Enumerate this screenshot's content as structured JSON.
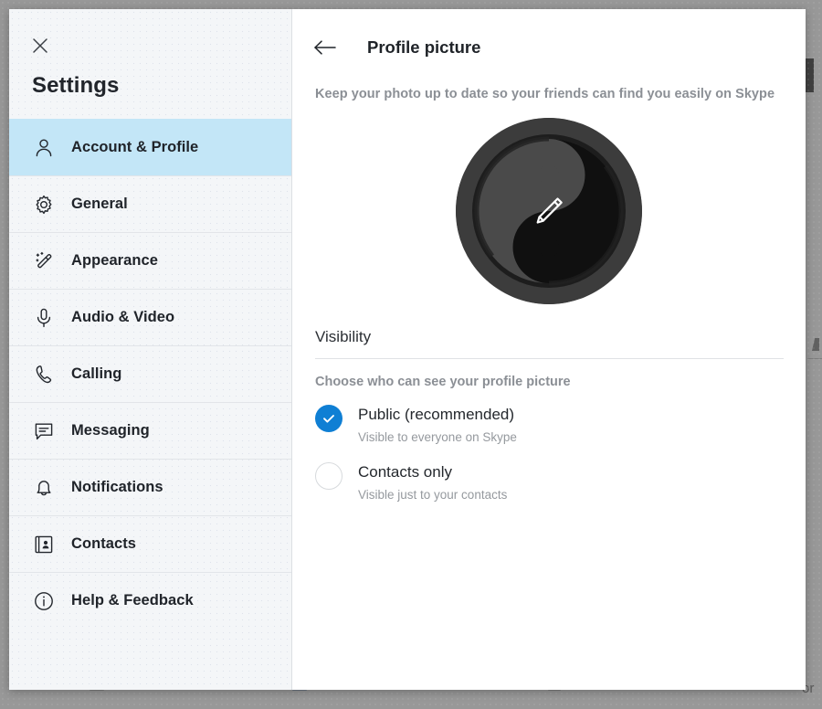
{
  "background": {
    "edge_text_fragment": "or",
    "ghost_word_positions": [
      98,
      320,
      600,
      940
    ]
  },
  "dialog": {
    "sidebar": {
      "close_icon": "close-icon",
      "title": "Settings",
      "items": [
        {
          "label": "Account & Profile",
          "icon": "person-icon",
          "active": true
        },
        {
          "label": "General",
          "icon": "gear-icon",
          "active": false
        },
        {
          "label": "Appearance",
          "icon": "magic-wand-icon",
          "active": false
        },
        {
          "label": "Audio & Video",
          "icon": "microphone-icon",
          "active": false
        },
        {
          "label": "Calling",
          "icon": "phone-icon",
          "active": false
        },
        {
          "label": "Messaging",
          "icon": "chat-bubble-icon",
          "active": false
        },
        {
          "label": "Notifications",
          "icon": "bell-icon",
          "active": false
        },
        {
          "label": "Contacts",
          "icon": "address-book-icon",
          "active": false
        },
        {
          "label": "Help & Feedback",
          "icon": "info-circle-icon",
          "active": false
        }
      ]
    },
    "main": {
      "back_icon": "back-arrow-icon",
      "title": "Profile picture",
      "subtitle": "Keep your photo up to date so your friends can find you easily on Skype",
      "avatar": {
        "image_description": "yin-yang symbol",
        "edit_icon": "pencil-icon"
      },
      "visibility": {
        "heading": "Visibility",
        "description": "Choose who can see your profile picture",
        "options": [
          {
            "label": "Public (recommended)",
            "sublabel": "Visible to everyone on Skype",
            "selected": true
          },
          {
            "label": "Contacts only",
            "sublabel": "Visible just to your contacts",
            "selected": false
          }
        ]
      }
    }
  },
  "colors": {
    "accent_blue": "#0f7fd4",
    "sidebar_active": "#c3e6f7",
    "sidebar_bg": "#f4f6f8",
    "text_primary": "#20242a",
    "text_muted": "#8b8f95"
  }
}
